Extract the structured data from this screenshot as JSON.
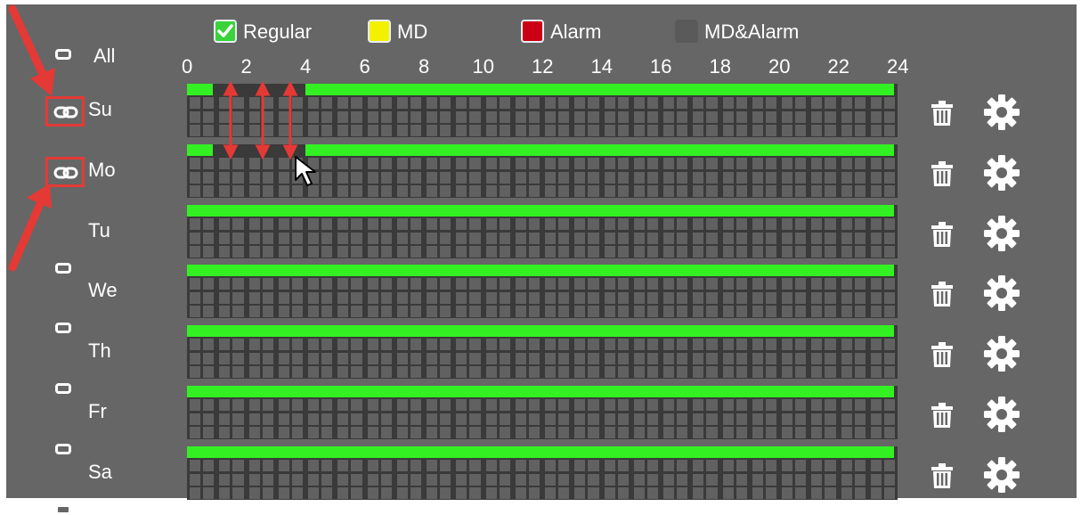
{
  "colors": {
    "panel_bg": "#666666",
    "track_dark": "#3a3a3a",
    "track_light": "#616161",
    "regular_green": "#33f022",
    "md_yellow": "#f3f000",
    "alarm_red": "#cc0015",
    "md_alarm_gray": "#5a5a5a",
    "annotation_red": "#e53935"
  },
  "legend": [
    {
      "label": "Regular",
      "color": "#3bd33b",
      "checked": true
    },
    {
      "label": "MD",
      "color": "#f3f000",
      "checked": false
    },
    {
      "label": "Alarm",
      "color": "#cc0015",
      "checked": false
    },
    {
      "label": "MD&Alarm",
      "color": "#5a5a5a",
      "checked": false
    }
  ],
  "all_label": "All",
  "hour_ticks": [
    "0",
    "2",
    "4",
    "6",
    "8",
    "10",
    "12",
    "14",
    "16",
    "18",
    "20",
    "22",
    "24"
  ],
  "days": [
    {
      "label": "Su",
      "linked": true,
      "schedule": [
        [
          0,
          1
        ],
        [
          4,
          24
        ]
      ]
    },
    {
      "label": "Mo",
      "linked": true,
      "schedule": [
        [
          0,
          1
        ],
        [
          4,
          24
        ]
      ]
    },
    {
      "label": "Tu",
      "linked": false,
      "schedule": [
        [
          0,
          24
        ]
      ]
    },
    {
      "label": "We",
      "linked": false,
      "schedule": [
        [
          0,
          24
        ]
      ]
    },
    {
      "label": "Th",
      "linked": false,
      "schedule": [
        [
          0,
          24
        ]
      ]
    },
    {
      "label": "Fr",
      "linked": false,
      "schedule": [
        [
          0,
          24
        ]
      ]
    },
    {
      "label": "Sa",
      "linked": false,
      "schedule": [
        [
          0,
          24
        ]
      ]
    }
  ],
  "icons": {
    "link": "link-icon",
    "delete": "trash-icon",
    "settings": "gear-icon",
    "cursor": "mouse-pointer-icon"
  }
}
